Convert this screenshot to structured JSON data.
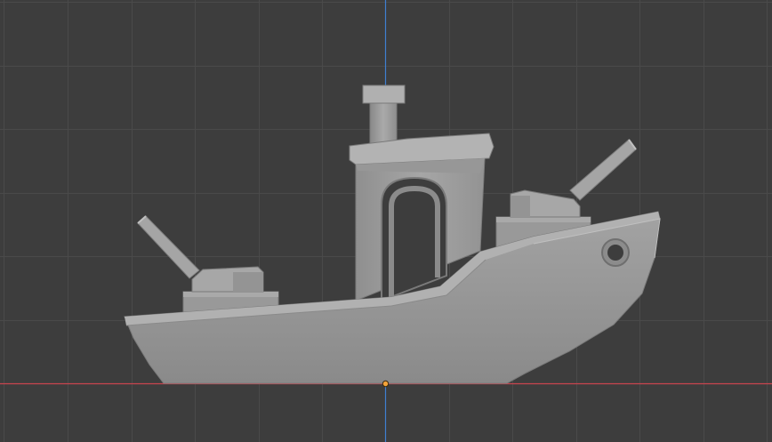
{
  "viewport": {
    "view": "3d-viewport-side-orthographic",
    "background_color": "#3d3d3d",
    "grid_color": "#4a4a4a",
    "x_axis_color": "#c9444f",
    "z_axis_color": "#3f7fd0",
    "origin_color": "#f2a33a",
    "model_color": "#9a9a9a"
  },
  "model": {
    "name": "benchy-boat",
    "parts": [
      "hull",
      "cabin",
      "chimney",
      "rear-turret",
      "front-turret",
      "rear-gun-barrel",
      "front-gun-barrel",
      "porthole",
      "cabin-door-opening"
    ]
  }
}
